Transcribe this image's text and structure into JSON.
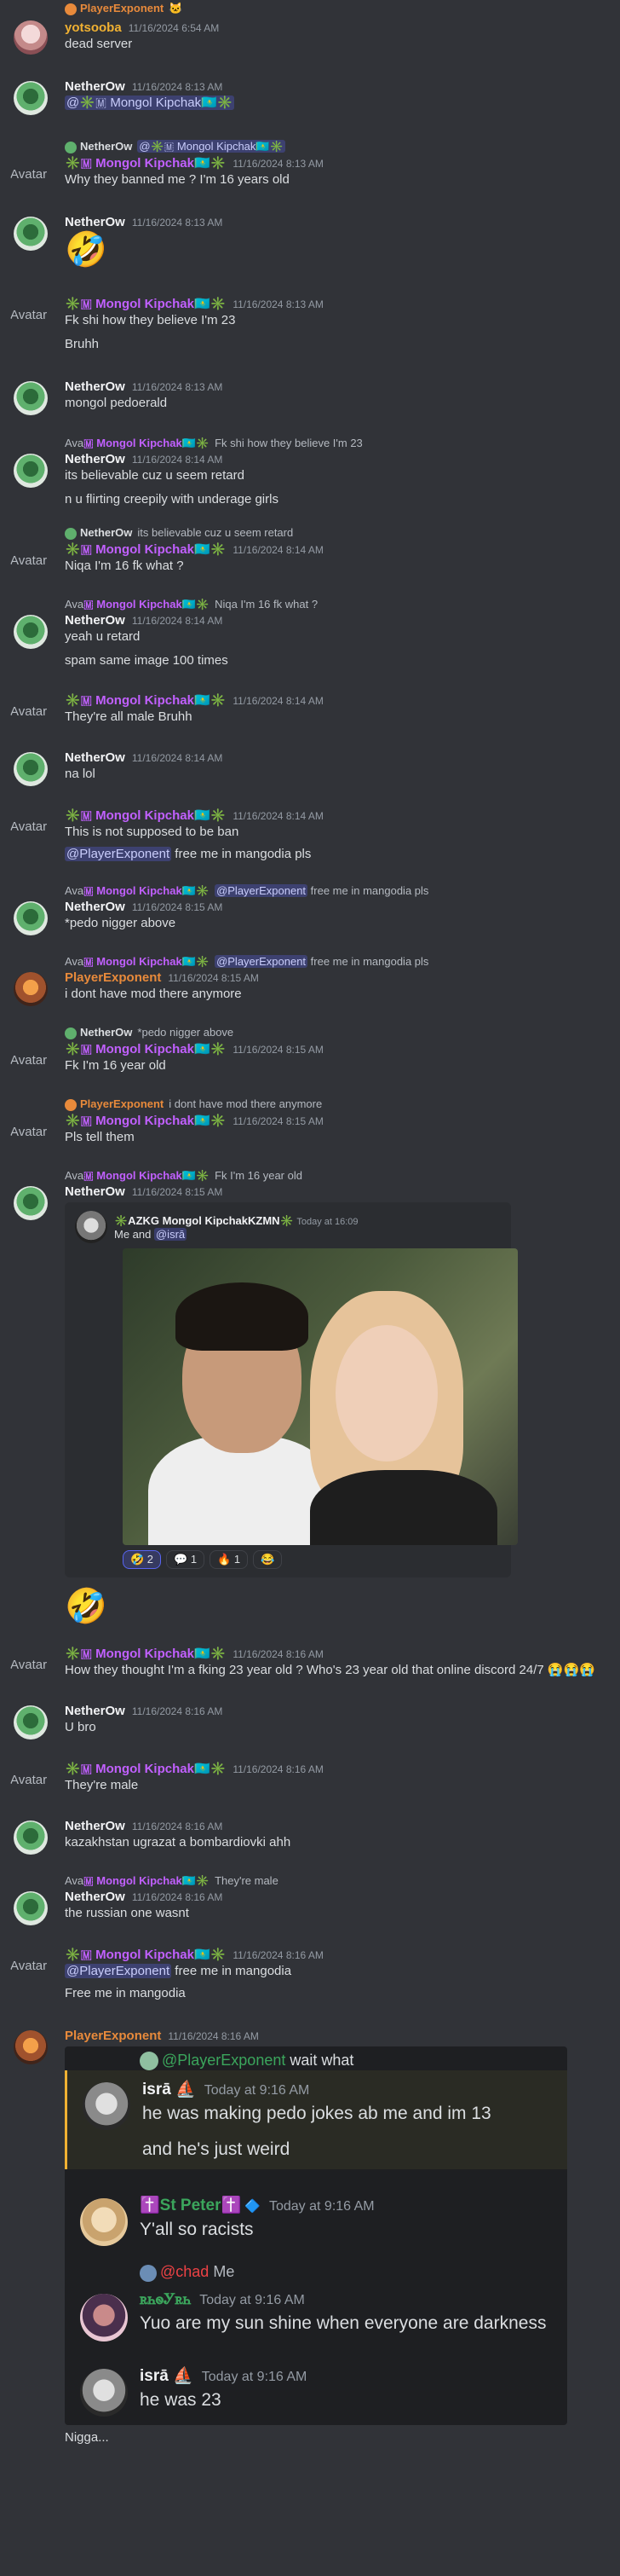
{
  "top_reply": {
    "name": "PlayerExponent"
  },
  "m1": {
    "name": "yotsooba",
    "ts": "11/16/2024 6:54 AM",
    "text": "dead server"
  },
  "m2": {
    "name": "NetherOw",
    "ts": "11/16/2024 8:13 AM",
    "text": "@✳️🇲 Mongol Kipchak🇰🇿✳️"
  },
  "m3": {
    "reply_name": "NetherOw",
    "reply_text": "@✳️🇲 Mongol Kipchak🇰🇿✳️",
    "avatar": "Avatar",
    "name": "✳️🇲 Mongol Kipchak🇰🇿✳️",
    "ts": "11/16/2024 8:13 AM",
    "text": "Why they banned me ? I'm 16 years old"
  },
  "m4": {
    "name": "NetherOw",
    "ts": "11/16/2024 8:13 AM",
    "emoji": "🤣"
  },
  "m5": {
    "avatar": "Avatar",
    "name": "✳️🇲 Mongol Kipchak🇰🇿✳️",
    "ts": "11/16/2024 8:13 AM",
    "text1": "Fk shi how they believe I'm 23",
    "text2": "Bruhh"
  },
  "m6": {
    "name": "NetherOw",
    "ts": "11/16/2024 8:13 AM",
    "text": "mongol pedoerald"
  },
  "m7": {
    "reply_prefix": "Ava",
    "reply_name": "🇲 Mongol Kipchak🇰🇿✳️",
    "reply_text": "Fk shi how they believe I'm 23",
    "name": "NetherOw",
    "ts": "11/16/2024 8:14 AM",
    "text1": "its believable cuz u seem retard",
    "text2": "n u flirting creepily with underage girls"
  },
  "m8": {
    "reply_name": "NetherOw",
    "reply_text": "its believable cuz u seem retard",
    "avatar": "Avatar",
    "name": "✳️🇲 Mongol Kipchak🇰🇿✳️",
    "ts": "11/16/2024 8:14 AM",
    "text": "Niqa I'm 16 fk what ?"
  },
  "m9": {
    "reply_prefix": "Ava",
    "reply_name": "🇲 Mongol Kipchak🇰🇿✳️",
    "reply_text": "Niqa I'm 16 fk what ?",
    "name": "NetherOw",
    "ts": "11/16/2024 8:14 AM",
    "text1": "yeah u retard",
    "text2": "spam same image 100 times"
  },
  "m10": {
    "avatar": "Avatar",
    "name": "✳️🇲 Mongol Kipchak🇰🇿✳️",
    "ts": "11/16/2024 8:14 AM",
    "text": "They're all male Bruhh"
  },
  "m11": {
    "name": "NetherOw",
    "ts": "11/16/2024 8:14 AM",
    "text": "na lol"
  },
  "m12": {
    "avatar": "Avatar",
    "name": "✳️🇲 Mongol Kipchak🇰🇿✳️",
    "ts": "11/16/2024 8:14 AM",
    "text1": "This is not supposed to be ban",
    "mention": "@PlayerExponent",
    "text2": " free me in mangodia pls"
  },
  "m13": {
    "reply_prefix": "Ava",
    "reply_name": "🇲 Mongol Kipchak🇰🇿✳️",
    "reply_mention": "@PlayerExponent",
    "reply_text": " free me in mangodia pls",
    "name": "NetherOw",
    "ts": "11/16/2024 8:15 AM",
    "text": "*pedo nigger above"
  },
  "m14": {
    "reply_prefix": "Ava",
    "reply_name": "🇲 Mongol Kipchak🇰🇿✳️",
    "reply_mention": "@PlayerExponent",
    "reply_text": " free me in mangodia pls",
    "name": "PlayerExponent",
    "ts": "11/16/2024 8:15 AM",
    "text": "i dont have mod there anymore"
  },
  "m15": {
    "reply_name": "NetherOw",
    "reply_text": "*pedo nigger above",
    "avatar": "Avatar",
    "name": "✳️🇲 Mongol Kipchak🇰🇿✳️",
    "ts": "11/16/2024 8:15 AM",
    "text": "Fk I'm 16 year old"
  },
  "m16": {
    "reply_name": "PlayerExponent",
    "reply_text": "i dont have mod there anymore",
    "avatar": "Avatar",
    "name": "✳️🇲 Mongol Kipchak🇰🇿✳️",
    "ts": "11/16/2024 8:15 AM",
    "text": "Pls tell them"
  },
  "m17": {
    "reply_prefix": "Ava",
    "reply_name": "🇲 Mongol Kipchak🇰🇿✳️",
    "reply_text": "Fk I'm 16 year old",
    "name": "NetherOw",
    "ts": "11/16/2024 8:15 AM",
    "embed": {
      "author": "✳️AZKG Mongol KipchakKZMN✳️",
      "ts": "Today at 16:09",
      "text": "Me and ",
      "mention": "@isrā"
    },
    "reactions": [
      "🤣 2",
      "💬 1",
      "🔥 1",
      "😂"
    ]
  },
  "m18": {
    "emoji": "🤣"
  },
  "m19": {
    "avatar": "Avatar",
    "name": "✳️🇲 Mongol Kipchak🇰🇿✳️",
    "ts": "11/16/2024 8:16 AM",
    "text": "How they thought I'm a fking 23 year old ? Who's 23 year old that online discord 24/7 😭😭😭"
  },
  "m20": {
    "name": "NetherOw",
    "ts": "11/16/2024 8:16 AM",
    "text": "U bro"
  },
  "m21": {
    "avatar": "Avatar",
    "name": "✳️🇲 Mongol Kipchak🇰🇿✳️",
    "ts": "11/16/2024 8:16 AM",
    "text": "They're male"
  },
  "m22": {
    "name": "NetherOw",
    "ts": "11/16/2024 8:16 AM",
    "text": "kazakhstan ugrazat a bombardiovki ahh"
  },
  "m23": {
    "reply_prefix": "Ava",
    "reply_name": "🇲 Mongol Kipchak🇰🇿✳️",
    "reply_text": "They're male",
    "name": "NetherOw",
    "ts": "11/16/2024 8:16 AM",
    "text": "the russian one wasnt"
  },
  "m24": {
    "avatar": "Avatar",
    "name": "✳️🇲 Mongol Kipchak🇰🇿✳️",
    "ts": "11/16/2024 8:16 AM",
    "mention": "@PlayerExponent",
    "text1": " free me in mangodia",
    "text2": "Free me in mangodia"
  },
  "m25": {
    "name": "PlayerExponent",
    "ts": "11/16/2024 8:16 AM",
    "panel": {
      "reply_mention": "@PlayerExponent",
      "reply_text": "wait what",
      "isra1_name": "isrā ⛵",
      "isra1_ts": "Today at 9:16 AM",
      "isra1_text1": "he was making pedo jokes ab me and im 13",
      "isra1_text2": "and he's just weird",
      "peter_name": "✝️St Peter✝️",
      "peter_badge": "🔷",
      "peter_ts": "Today at 9:16 AM",
      "peter_text": "Y'all so racists",
      "sub_name": "@chad",
      "sub_text": "Me",
      "ahn_name": "ꭱꮒꮻᎩꭱꮒ",
      "ahn_ts": "Today at 9:16 AM",
      "ahn_text": "Yuo are my sun shine when everyone are darkness",
      "isra2_name": "isrā ⛵",
      "isra2_ts": "Today at 9:16 AM",
      "isra2_text": "he was 23"
    },
    "text": "Nigga..."
  }
}
